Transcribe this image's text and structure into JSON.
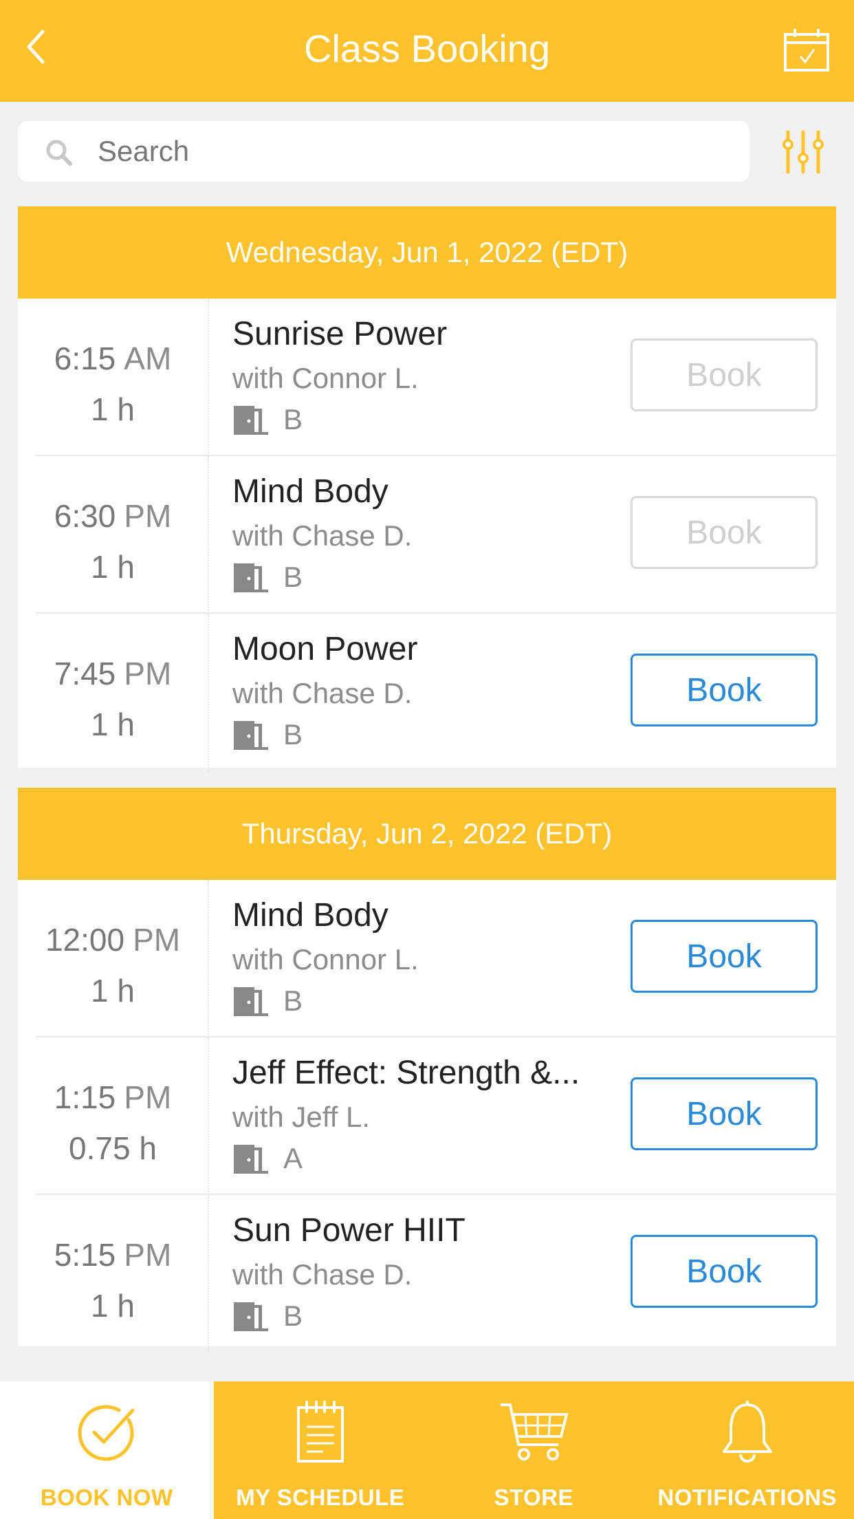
{
  "header": {
    "title": "Class Booking"
  },
  "search": {
    "placeholder": "Search"
  },
  "sections": [
    {
      "date": "Wednesday, Jun 1, 2022 (EDT)",
      "classes": [
        {
          "time": "6:15",
          "ampm": "AM",
          "duration": "1 h",
          "name": "Sunrise Power",
          "instructor": "with Connor L.",
          "room": "B",
          "book": "Book",
          "bookable": false
        },
        {
          "time": "6:30",
          "ampm": "PM",
          "duration": "1 h",
          "name": "Mind Body",
          "instructor": "with Chase D.",
          "room": "B",
          "book": "Book",
          "bookable": false
        },
        {
          "time": "7:45",
          "ampm": "PM",
          "duration": "1 h",
          "name": "Moon Power",
          "instructor": "with Chase D.",
          "room": "B",
          "book": "Book",
          "bookable": true
        }
      ]
    },
    {
      "date": "Thursday, Jun 2, 2022 (EDT)",
      "classes": [
        {
          "time": "12:00",
          "ampm": "PM",
          "duration": "1 h",
          "name": "Mind Body",
          "instructor": "with Connor L.",
          "room": "B",
          "book": "Book",
          "bookable": true
        },
        {
          "time": "1:15",
          "ampm": "PM",
          "duration": "0.75 h",
          "name": "Jeff Effect: Strength &...",
          "instructor": "with Jeff L.",
          "room": "A",
          "book": "Book",
          "bookable": true
        },
        {
          "time": "5:15",
          "ampm": "PM",
          "duration": "1 h",
          "name": "Sun Power HIIT",
          "instructor": "with Chase D.",
          "room": "B",
          "book": "Book",
          "bookable": true
        }
      ]
    }
  ],
  "tabs": [
    {
      "label": "BOOK NOW",
      "icon": "check-circle-icon",
      "active": true
    },
    {
      "label": "MY SCHEDULE",
      "icon": "schedule-icon",
      "active": false
    },
    {
      "label": "STORE",
      "icon": "cart-icon",
      "active": false
    },
    {
      "label": "NOTIFICATIONS",
      "icon": "bell-icon",
      "active": false
    }
  ],
  "colors": {
    "accent": "#fdc22c",
    "link": "#2a8ad8",
    "disabled": "#d9d9d9"
  }
}
